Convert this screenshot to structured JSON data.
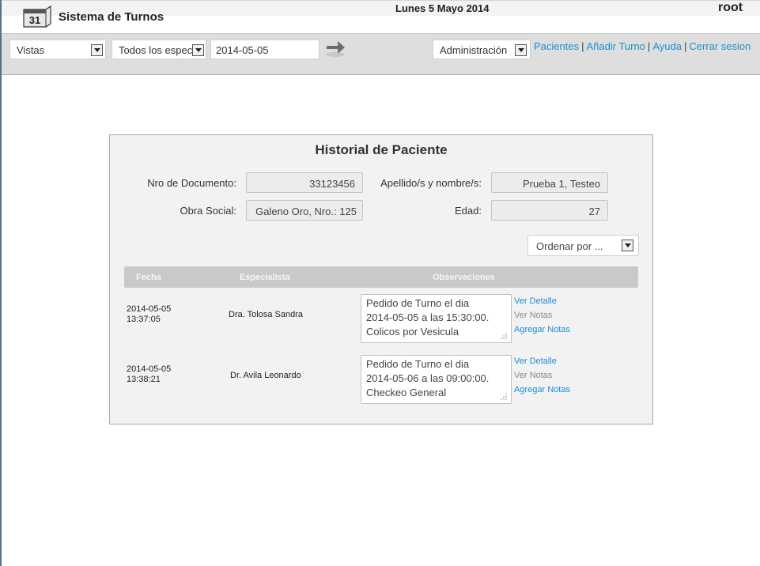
{
  "header": {
    "app_title": "Sistema de Turnos",
    "calendar_day": "31",
    "date": "Lunes 5 Mayo 2014",
    "user": "root"
  },
  "toolbar": {
    "vistas_select": "Vistas",
    "especialistas_select": "Todos los espec",
    "date_input": "2014-05-05",
    "admin_select": "Administración",
    "links": [
      "Pacientes",
      "Añadir Turno",
      "Ayuda",
      "Cerrar sesion"
    ]
  },
  "panel": {
    "title": "Historial de Paciente",
    "fields": {
      "documento_label": "Nro de Documento:",
      "documento_value": "33123456",
      "nombre_label": "Apellido/s y nombre/s:",
      "nombre_value": "Prueba 1, Testeo",
      "obra_label": "Obra Social:",
      "obra_value": "Galeno Oro, Nro.: 125",
      "edad_label": "Edad:",
      "edad_value": "27"
    },
    "order_select": "Ordenar por ...",
    "table": {
      "headers": [
        "Fecha",
        "Especialista",
        "Observaciones"
      ],
      "rows": [
        {
          "date": "2014-05-05",
          "time": "13:37:05",
          "specialist": "Dra. Tolosa Sandra",
          "obs_line1": "Pedido de Turno el dia",
          "obs_line2": "2014-05-05 a las 15:30:00.",
          "obs_line3": "Colicos por Vesicula",
          "links": [
            "Ver Detalle",
            "Ver Notas",
            "Agregar Notas"
          ]
        },
        {
          "date": "2014-05-05",
          "time": "13:38:21",
          "specialist": "Dr. Avila Leonardo",
          "obs_line1": "Pedido de Turno el dia",
          "obs_line2": "2014-05-06 a las 09:00:00.",
          "obs_line3": "Checkeo General",
          "links": [
            "Ver Detalle",
            "Ver Notas",
            "Agregar Notas"
          ]
        }
      ]
    }
  },
  "colors": {
    "link": "#1b8fd0",
    "toolbar_bg": "#dedede",
    "panel_bg": "#f2f2f2",
    "table_header_bg": "#c9c9c9"
  }
}
